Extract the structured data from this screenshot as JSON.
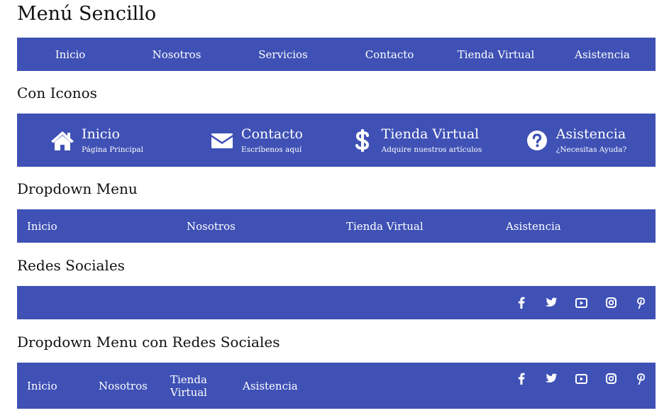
{
  "sections": {
    "simple_title": "Menú Sencillo",
    "icons_title": "Con Iconos",
    "dropdown_title": "Dropdown Menu",
    "social_title": "Redes Sociales",
    "combo_title": "Dropdown Menu con Redes Sociales"
  },
  "simple_menu": [
    "Inicio",
    "Nosotros",
    "Servicios",
    "Contacto",
    "Tienda Virtual",
    "Asistencia"
  ],
  "icon_menu": [
    {
      "label": "Inicio",
      "sub": "Página Principal",
      "icon": "home-icon"
    },
    {
      "label": "Contacto",
      "sub": "Escríbenos aquí",
      "icon": "envelope-icon"
    },
    {
      "label": "Tienda Virtual",
      "sub": "Adquire nuestros artículos",
      "icon": "dollar-icon"
    },
    {
      "label": "Asistencia",
      "sub": "¿Necesitas Ayuda?",
      "icon": "question-circle-icon"
    }
  ],
  "dropdown_menu": [
    "Inicio",
    "Nosotros",
    "Tienda Virtual",
    "Asistencia"
  ],
  "social_icons": [
    "facebook-icon",
    "twitter-icon",
    "youtube-icon",
    "instagram-icon",
    "pinterest-icon"
  ],
  "combo_menu": [
    "Inicio",
    "Nosotros",
    "Tienda Virtual",
    "Asistencia"
  ],
  "colors": {
    "bar": "#3f51b5",
    "text": "#ffffff",
    "heading": "#111111"
  }
}
